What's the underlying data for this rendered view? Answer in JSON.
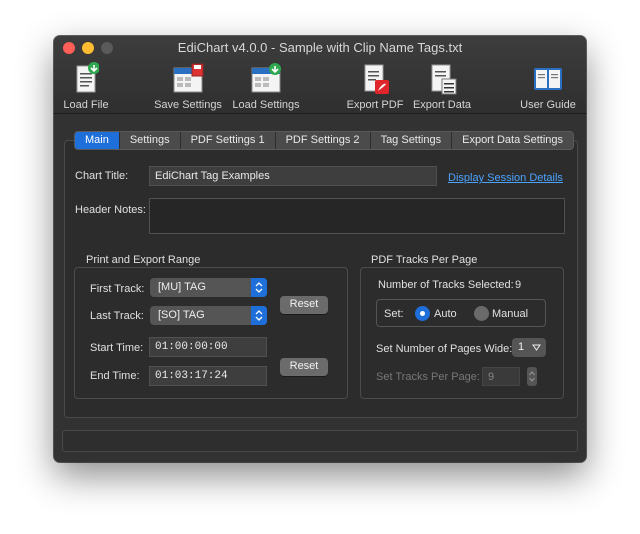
{
  "window": {
    "title": "EdiChart v4.0.0 - Sample with Clip Name Tags.txt"
  },
  "toolbar": {
    "load_file": "Load File",
    "save_settings": "Save Settings",
    "load_settings": "Load Settings",
    "export_pdf": "Export PDF",
    "export_data": "Export Data",
    "user_guide": "User Guide"
  },
  "tabs": [
    "Main",
    "Settings",
    "PDF Settings 1",
    "PDF Settings 2",
    "Tag Settings",
    "Export Data Settings"
  ],
  "active_tab": "Main",
  "main": {
    "chart_title_label": "Chart Title:",
    "chart_title_value": "EdiChart Tag Examples",
    "display_session_details": "Display Session Details",
    "header_notes_label": "Header Notes:",
    "header_notes_value": ""
  },
  "range": {
    "title": "Print and Export Range",
    "first_track_label": "First Track:",
    "first_track_value": "[MU] TAG",
    "last_track_label": "Last Track:",
    "last_track_value": "[SO] TAG",
    "reset_tracks": "Reset",
    "start_time_label": "Start Time:",
    "start_time_value": "01:00:00:00",
    "end_time_label": "End Time:",
    "end_time_value": "01:03:17:24",
    "reset_times": "Reset"
  },
  "pdf_tracks": {
    "title": "PDF Tracks Per Page",
    "selected_label": "Number of Tracks Selected:",
    "selected_value": "9",
    "set_label": "Set:",
    "auto_label": "Auto",
    "manual_label": "Manual",
    "mode": "Auto",
    "pages_wide_label": "Set Number of Pages Wide:",
    "pages_wide_value": "1",
    "tracks_per_page_label": "Set Tracks Per Page:",
    "tracks_per_page_value": "9"
  },
  "colors": {
    "accent": "#1e6fd9",
    "window_bg": "#323232",
    "link": "#4aa3ff"
  }
}
